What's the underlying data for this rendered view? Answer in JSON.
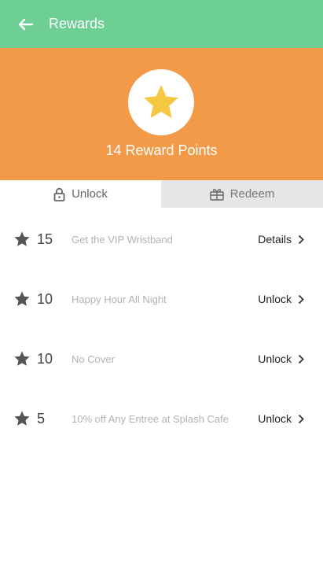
{
  "appbar": {
    "title": "Rewards",
    "back_icon": "arrow-left-icon"
  },
  "hero": {
    "points_text": "14 Reward Points",
    "badge_icon": "star-icon",
    "colors": {
      "appbar": "#6ecf95",
      "hero": "#f29a48",
      "star": "#f5c842"
    }
  },
  "tabs": [
    {
      "label": "Unlock",
      "icon": "lock-icon",
      "active": true
    },
    {
      "label": "Redeem",
      "icon": "gift-icon",
      "active": false
    }
  ],
  "rewards": [
    {
      "points": "15",
      "name": "Get the VIP Wristband",
      "action": "Details"
    },
    {
      "points": "10",
      "name": "Happy Hour All Night",
      "action": "Unlock"
    },
    {
      "points": "10",
      "name": "No Cover",
      "action": "Unlock"
    },
    {
      "points": "5",
      "name": "10% off Any Entree at Splash Cafe",
      "action": "Unlock"
    }
  ]
}
